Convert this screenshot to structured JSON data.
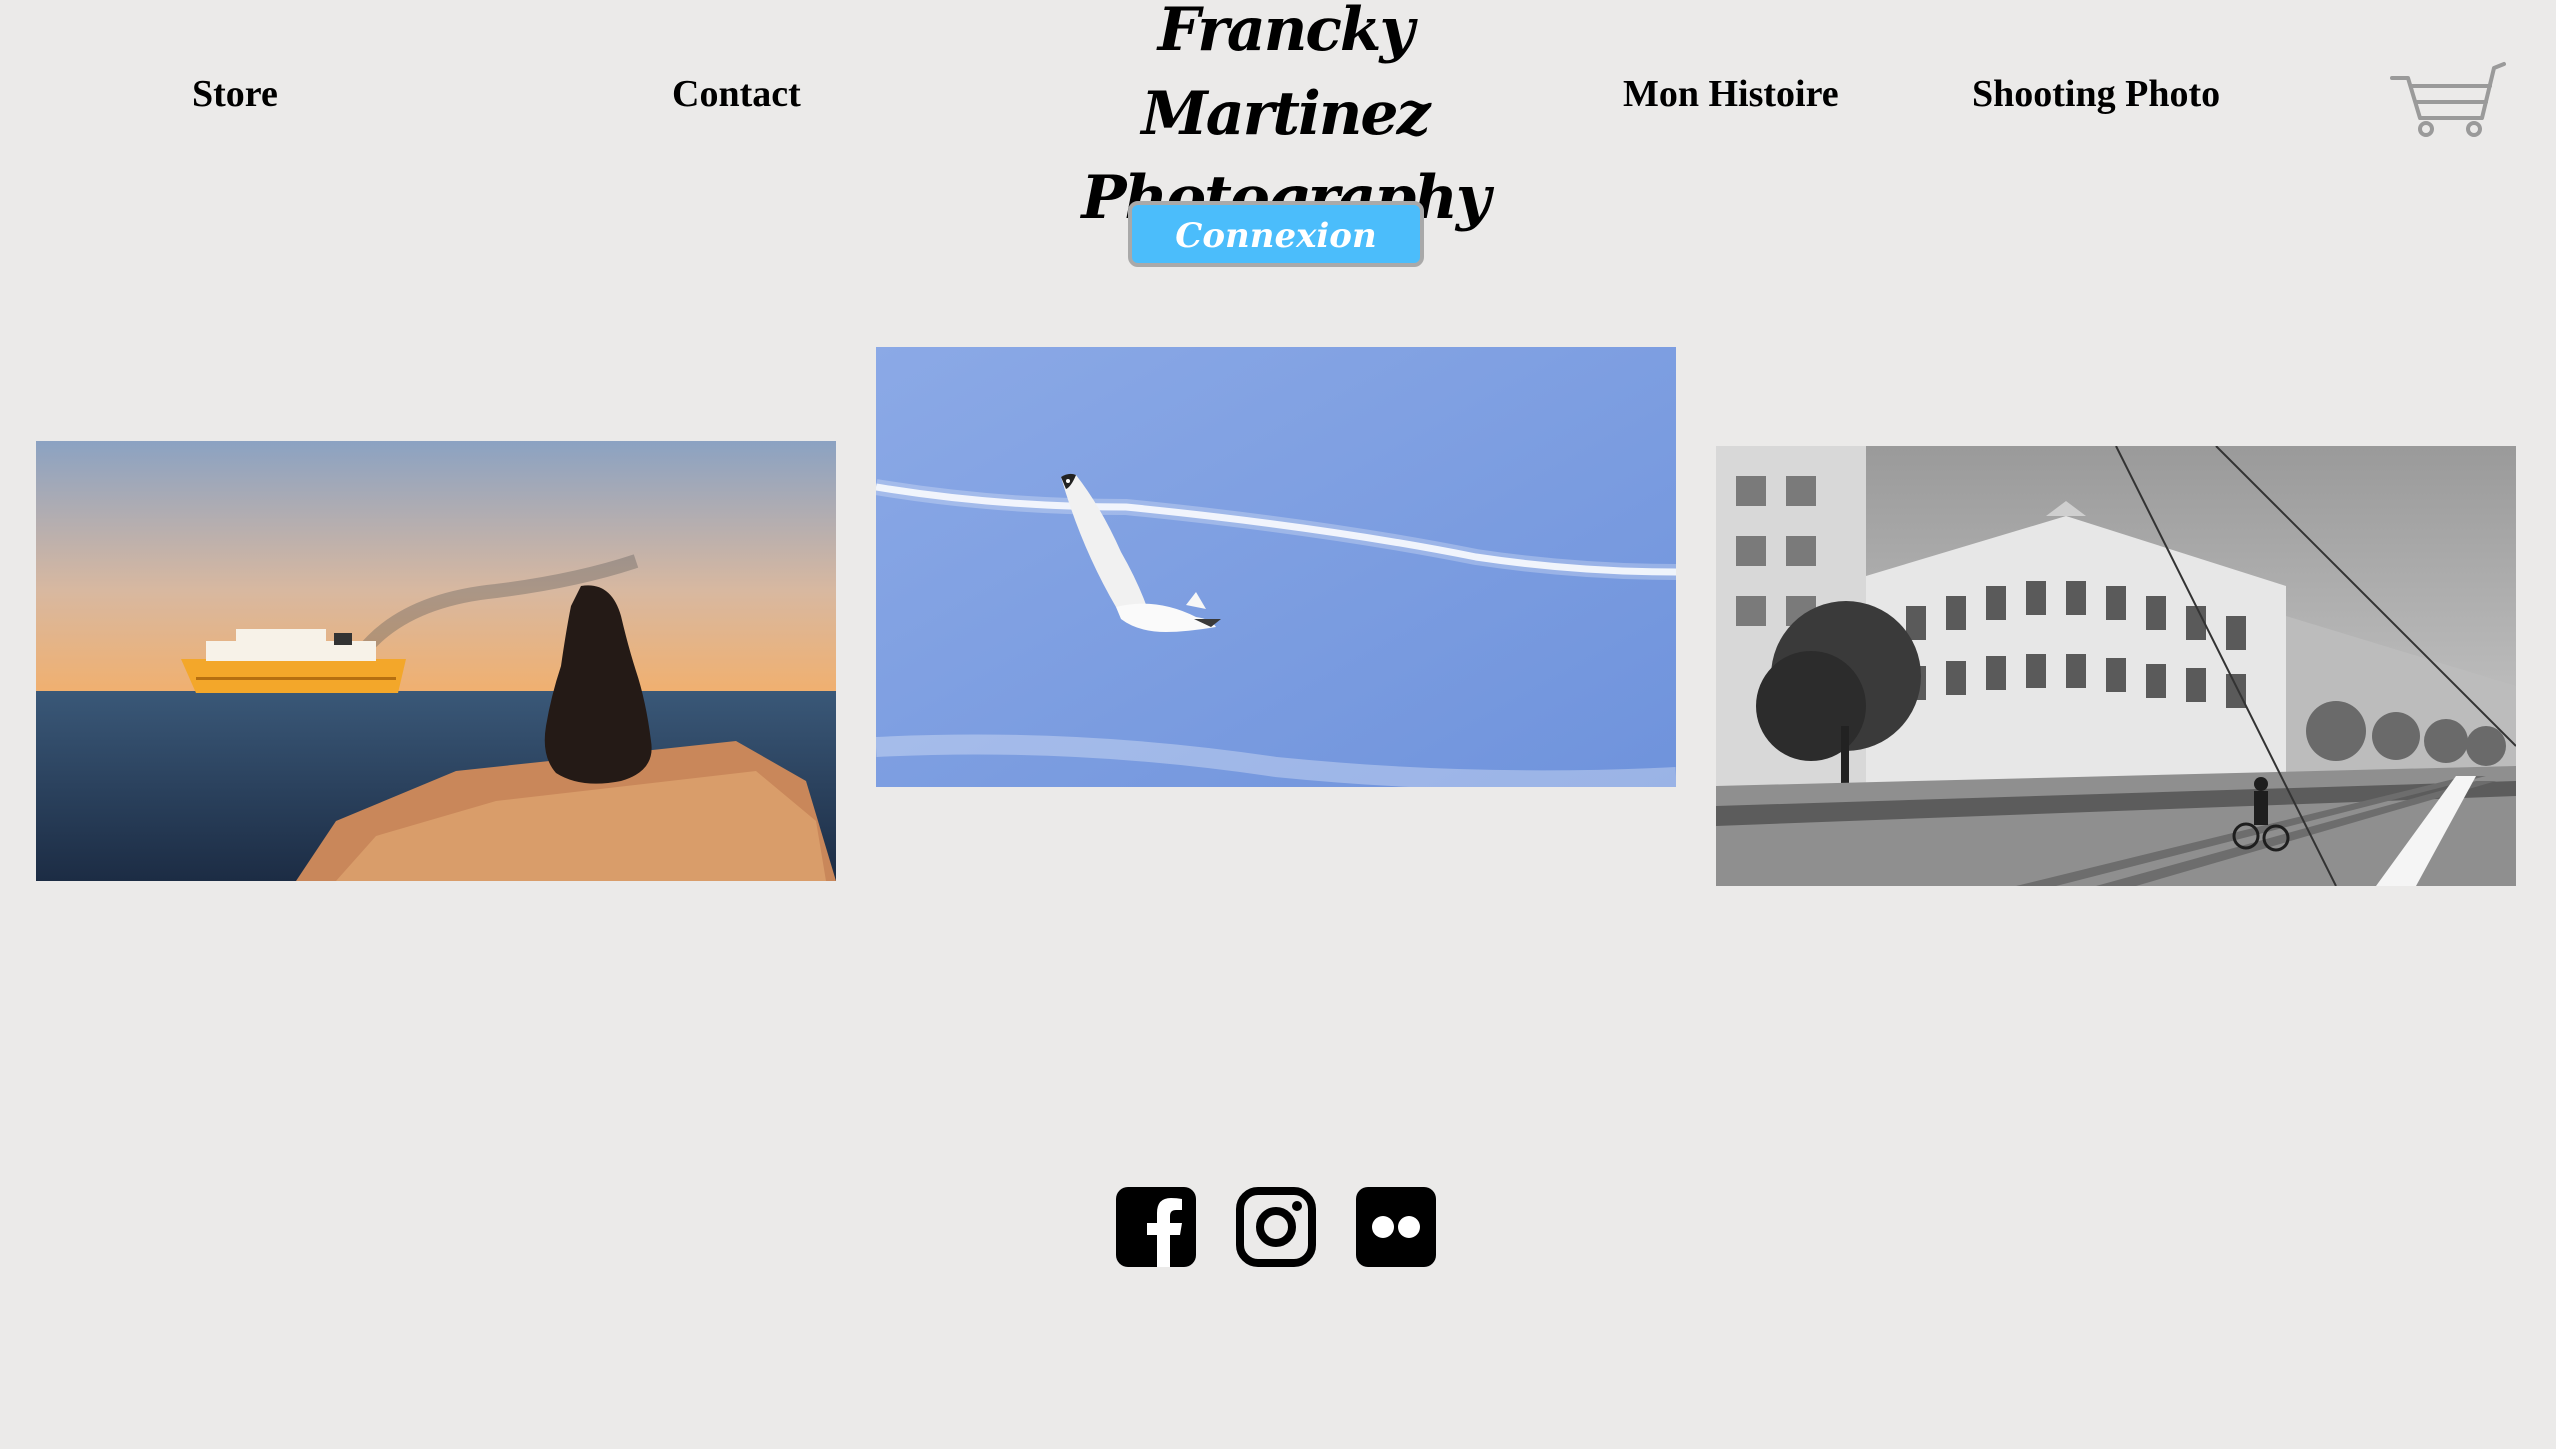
{
  "nav": {
    "store": "Store",
    "contact": "Contact",
    "histoire": "Mon Histoire",
    "shooting": "Shooting Photo"
  },
  "brand": {
    "line1": "Francky Martinez",
    "line2": "Photography"
  },
  "login": {
    "label": "Connexion"
  },
  "icons": {
    "cart": "cart-icon",
    "facebook": "facebook-icon",
    "instagram": "instagram-icon",
    "flickr": "flickr-icon"
  },
  "colors": {
    "background": "#ebeae9",
    "login_button": "#4bbdfb",
    "text": "#000000"
  }
}
